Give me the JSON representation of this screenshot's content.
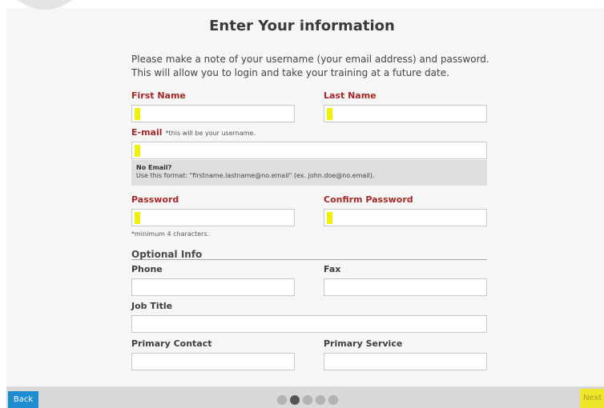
{
  "page": {
    "title": "Enter Your information",
    "intro_line1": "Please make a note of your username (your email address) and password.",
    "intro_line2": "This will allow you to login and take your training at a future date."
  },
  "form": {
    "first_name_label": "First Name",
    "last_name_label": "Last Name",
    "email_label": "E-mail",
    "email_hint": "*this will be your username.",
    "no_email_title": "No Email?",
    "no_email_text": "Use this format: \"firstname.lastname@no.email\" (ex. john.doe@no.email).",
    "password_label": "Password",
    "confirm_password_label": "Confirm Password",
    "password_note": "*minimum 4 characters.",
    "optional_heading": "Optional Info",
    "phone_label": "Phone",
    "fax_label": "Fax",
    "job_title_label": "Job Title",
    "primary_contact_label": "Primary Contact",
    "primary_service_label": "Primary Service"
  },
  "footer": {
    "back_label": "Back",
    "next_label": "Next",
    "progress_total": 5,
    "progress_current": 2
  },
  "colors": {
    "required_label": "#a3282a",
    "highlight": "#f1f200",
    "back_button": "#1f8bd1"
  }
}
